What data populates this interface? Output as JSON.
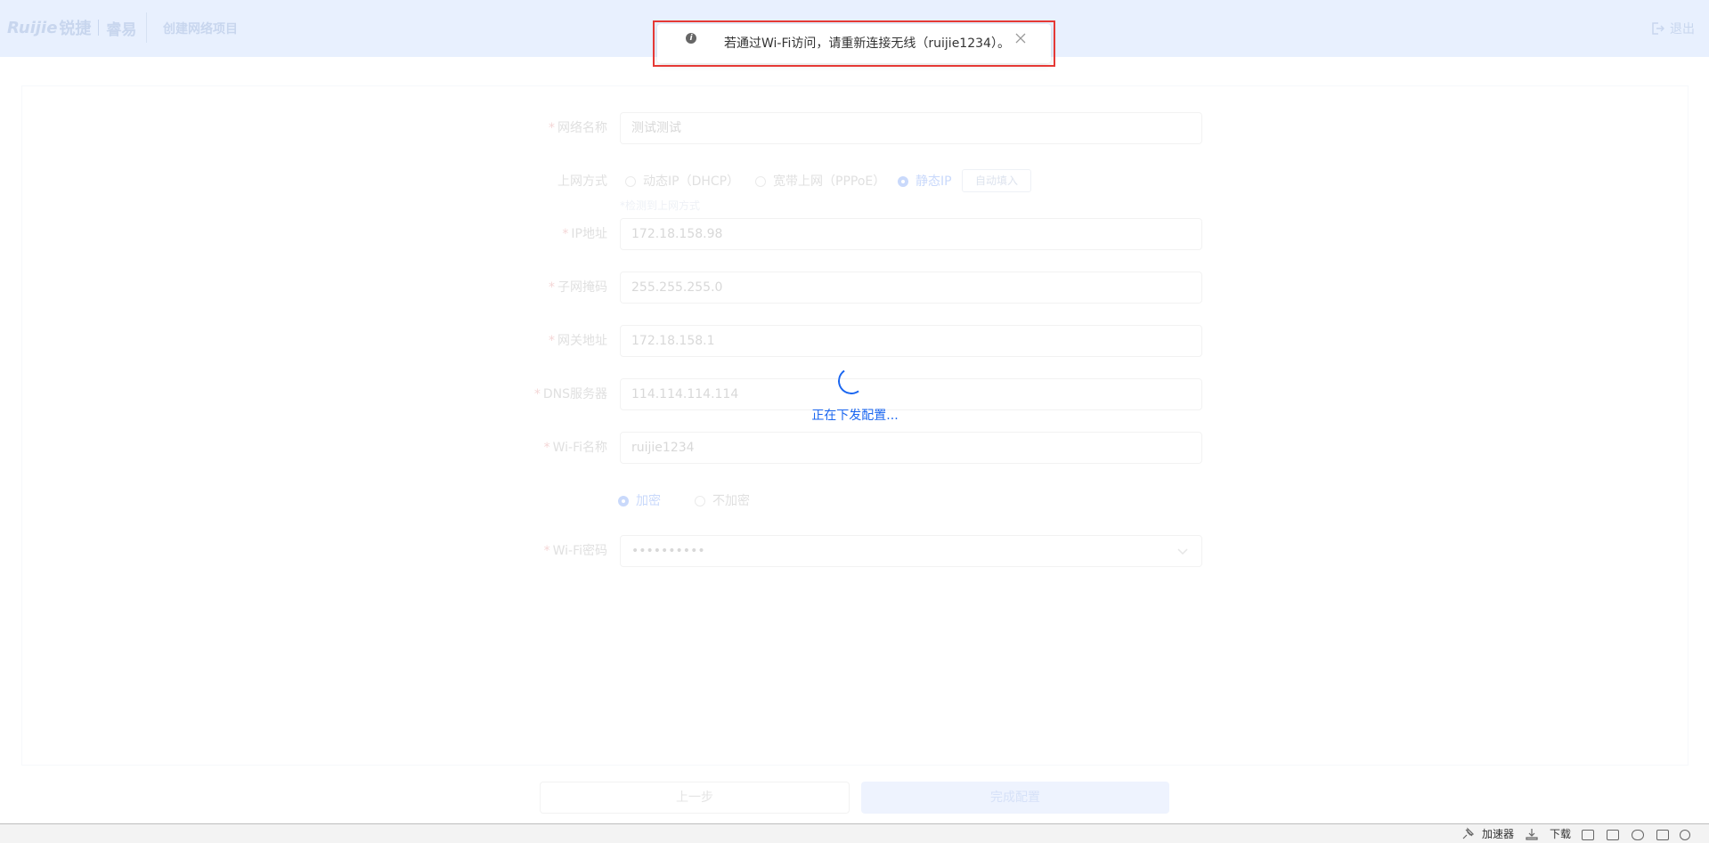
{
  "header": {
    "logo_brand": "Ruijie",
    "logo_brand_cn": "锐捷",
    "logo_sub": "睿易",
    "project_title": "创建网络项目",
    "logout_label": "退出"
  },
  "form": {
    "network_name": {
      "label": "网络名称",
      "value": "测试测试"
    },
    "internet_mode": {
      "label": "上网方式",
      "options": [
        "动态IP（DHCP）",
        "宽带上网（PPPoE）",
        "静态IP"
      ],
      "selected": "静态IP",
      "auto_fill_button": "自动填入",
      "hint": "*检测到上网方式"
    },
    "ip_address": {
      "label": "IP地址",
      "value": "172.18.158.98"
    },
    "subnet_mask": {
      "label": "子网掩码",
      "value": "255.255.255.0"
    },
    "gateway": {
      "label": "网关地址",
      "value": "172.18.158.1"
    },
    "dns_server": {
      "label": "DNS服务器",
      "value": "114.114.114.114"
    },
    "wifi_name": {
      "label": "Wi-Fi名称",
      "value": "ruijie1234"
    },
    "encryption": {
      "options": [
        "加密",
        "不加密"
      ],
      "selected": "加密"
    },
    "wifi_password": {
      "label": "Wi-Fi密码",
      "value": "••••••••••"
    }
  },
  "loading": {
    "text": "正在下发配置..."
  },
  "footer": {
    "prev_button": "上一步",
    "finish_button": "完成配置"
  },
  "toast": {
    "message": "若通过Wi-Fi访问，请重新连接无线（ruijie1234）。"
  },
  "statusbar": {
    "accelerator": "加速器",
    "download": "下载"
  },
  "colors": {
    "accent": "#1a66f0",
    "highlight": "#e53935",
    "header_bg": "#e8f0fe"
  }
}
